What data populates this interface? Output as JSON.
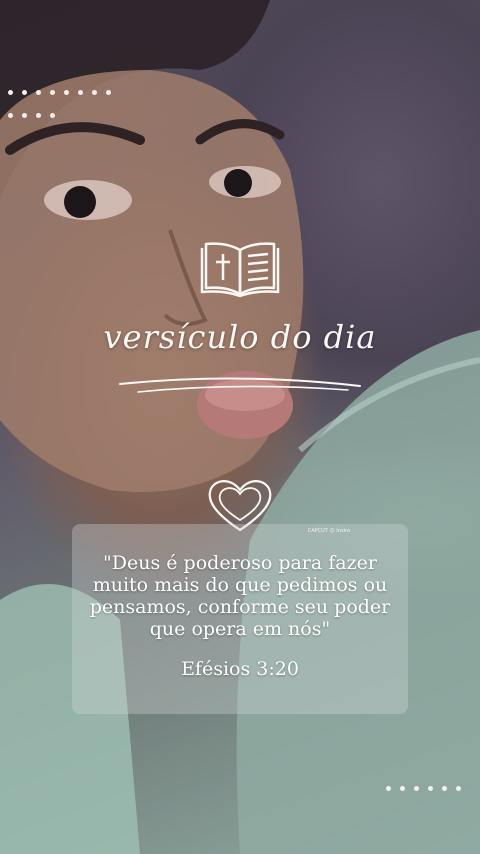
{
  "background": {
    "description_icon": "selfie-photo-background",
    "colors": {
      "pillow": "#5d5566",
      "skin": "#9a7a6a",
      "shirt": "#8fa8a0"
    }
  },
  "header": {
    "icon": "open-bible-with-cross-icon",
    "title": "versículo do dia",
    "decoration": "swoosh-underline"
  },
  "heart": {
    "icon": "double-heart-outline-icon"
  },
  "card": {
    "watermark": "CAPCUT ☺ Insira",
    "verse": "\"Deus é poderoso para fazer muito mais do que pedimos ou pensamos, conforme seu poder que opera em nós\"",
    "reference": "Efésios 3:20"
  },
  "decorations": {
    "dot_color": "#f4f0ee",
    "top_row_1_count": 8,
    "top_row_2_count": 4,
    "bottom_row_count": 6
  }
}
